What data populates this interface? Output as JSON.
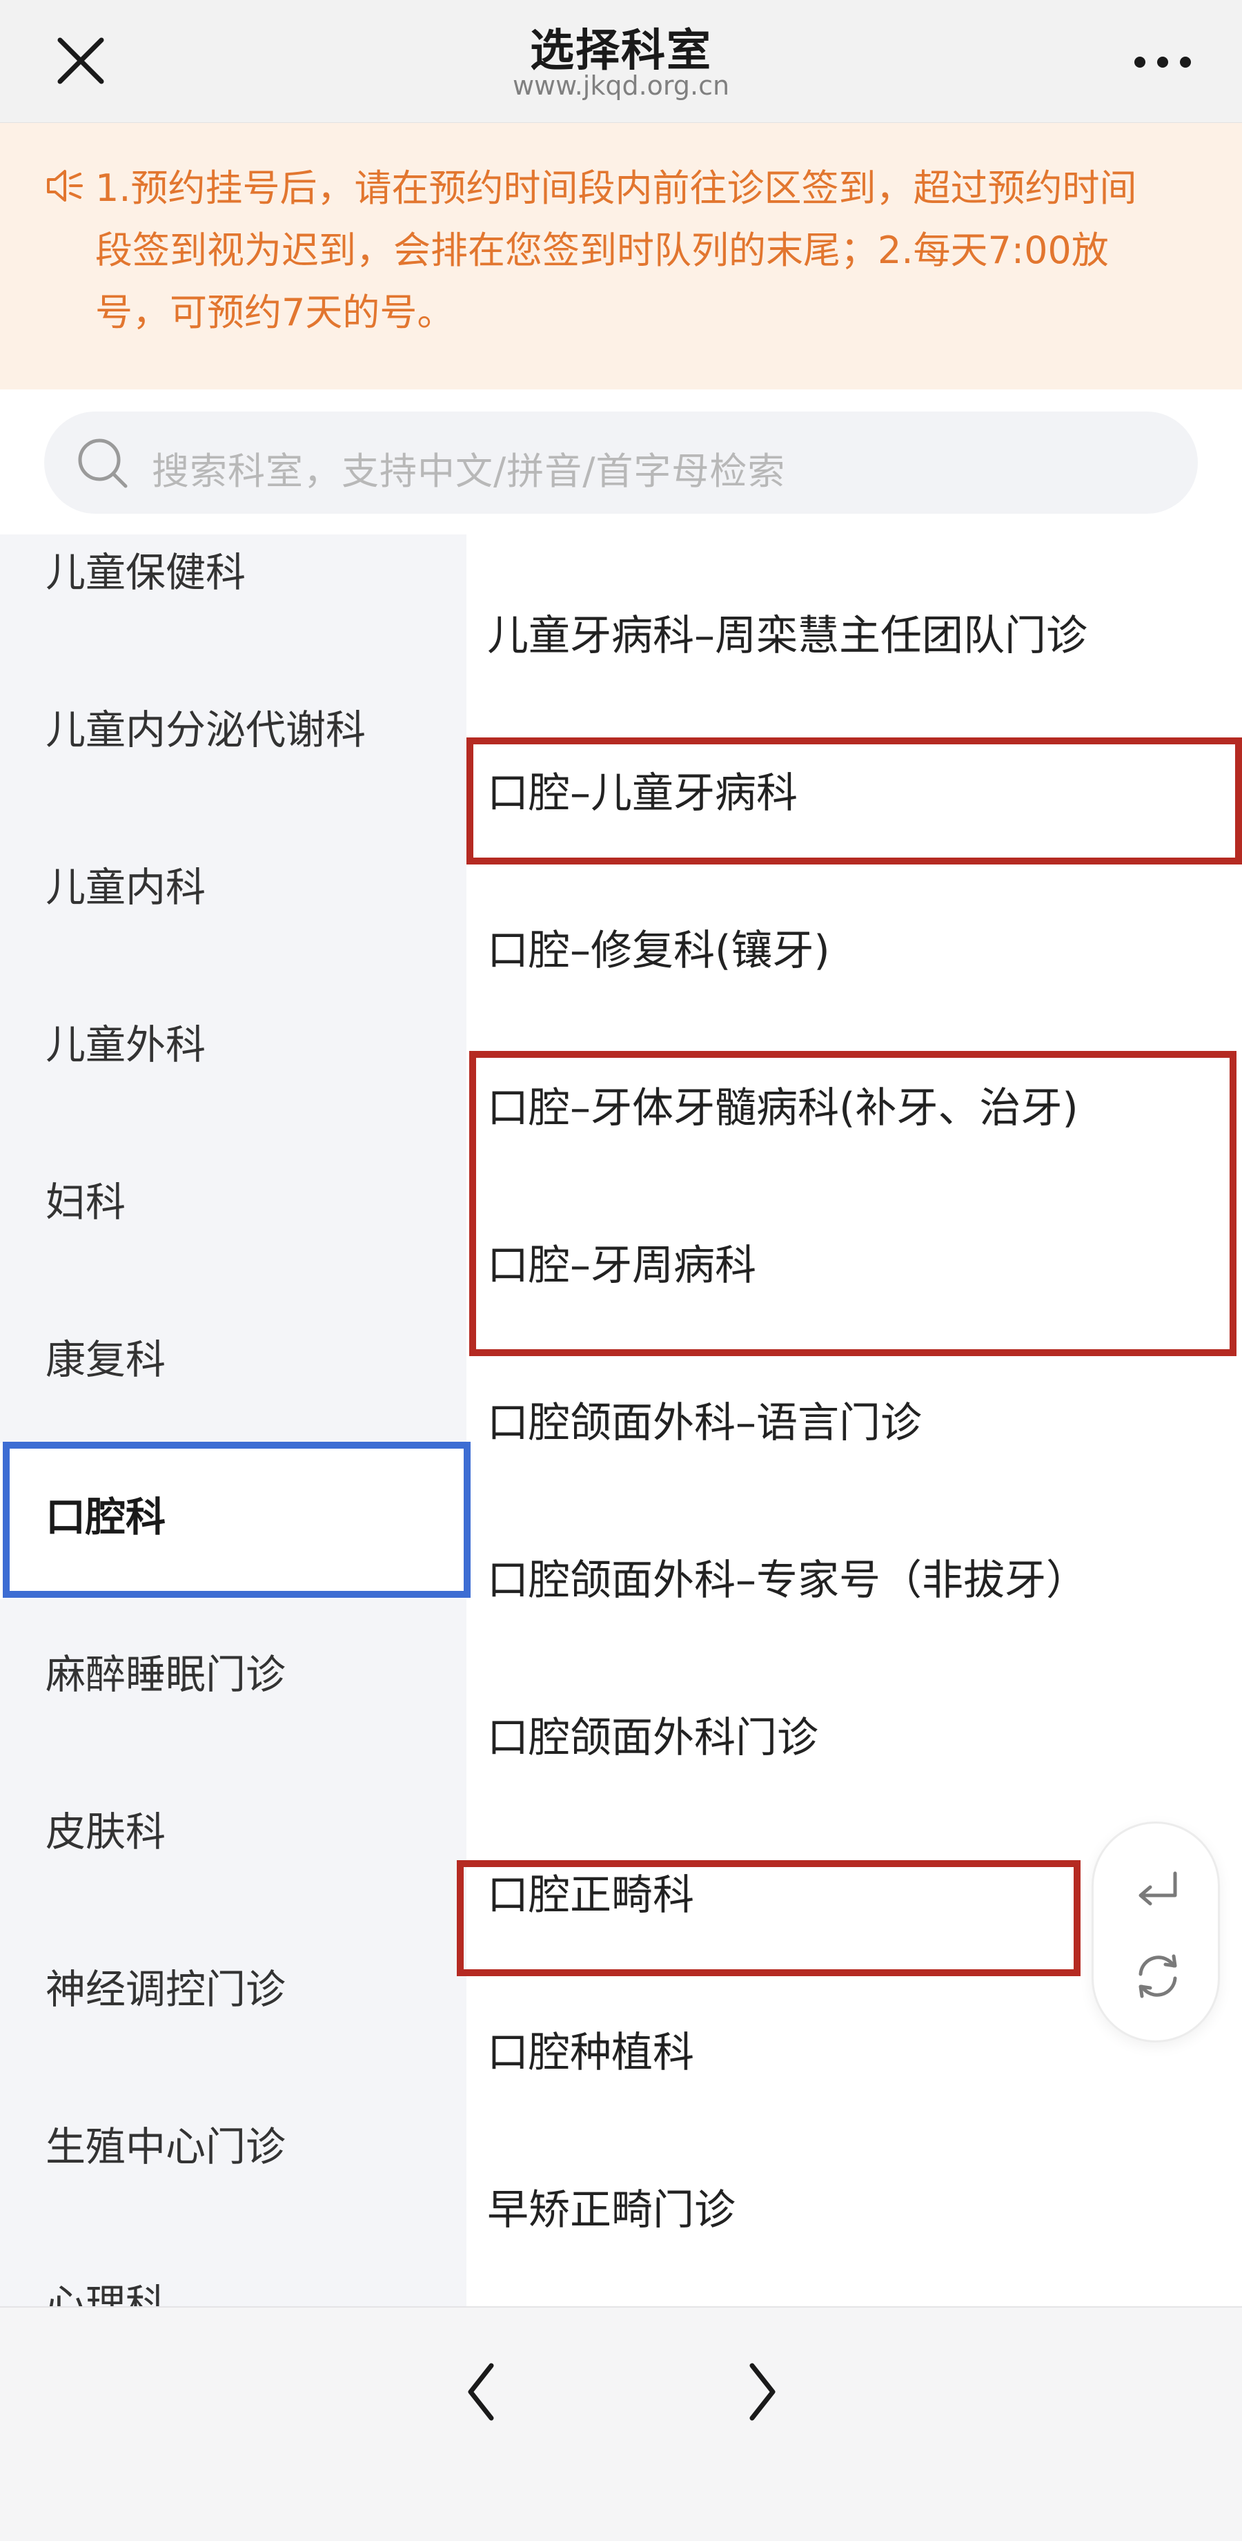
{
  "header": {
    "title": "选择科室",
    "subtitle": "www.jkqd.org.cn",
    "close_icon": "close-icon",
    "more_icon": "more-icon"
  },
  "notice": {
    "icon": "speaker-icon",
    "lines": [
      "1.预约挂号后，请在预约时间段内前往诊区签到，超过预约时间",
      "段签到视为迟到，会排在您签到时队列的末尾；2.每天7:00放",
      "号，可预约7天的号。"
    ],
    "color": "#e2762f"
  },
  "search": {
    "placeholder": "搜索科室，支持中文/拼音/首字母检索",
    "icon": "search-icon"
  },
  "categories": [
    {
      "label": "儿童保健科"
    },
    {
      "label": "儿童内分泌代谢科"
    },
    {
      "label": "儿童内科"
    },
    {
      "label": "儿童外科"
    },
    {
      "label": "妇科"
    },
    {
      "label": "康复科"
    },
    {
      "label": "口腔科",
      "active": true
    },
    {
      "label": "麻醉睡眠门诊"
    },
    {
      "label": "皮肤科"
    },
    {
      "label": "神经调控门诊"
    },
    {
      "label": "生殖中心门诊"
    },
    {
      "label": "心理科"
    }
  ],
  "departments": [
    {
      "label": "儿童牙病科–周栾慧主任团队门诊"
    },
    {
      "label": "口腔–儿童牙病科"
    },
    {
      "label": "口腔–修复科(镶牙)"
    },
    {
      "label": "口腔–牙体牙髓病科(补牙、治牙)"
    },
    {
      "label": "口腔–牙周病科"
    },
    {
      "label": "口腔颌面外科–语言门诊"
    },
    {
      "label": "口腔颌面外科–专家号（非拔牙）"
    },
    {
      "label": "口腔颌面外科门诊"
    },
    {
      "label": "口腔正畸科"
    },
    {
      "label": "口腔种植科"
    },
    {
      "label": "早矫正畸门诊"
    }
  ],
  "float_actions": {
    "back_icon": "return-icon",
    "refresh_icon": "refresh-icon"
  },
  "bottom_nav": {
    "back_icon": "chevron-left-icon",
    "forward_icon": "chevron-right-icon"
  },
  "colors": {
    "annotation_red": "#b52a22",
    "annotation_blue": "#3d6dd3",
    "notice_bg": "#fdf1e6",
    "left_bg": "#f4f5f8"
  }
}
